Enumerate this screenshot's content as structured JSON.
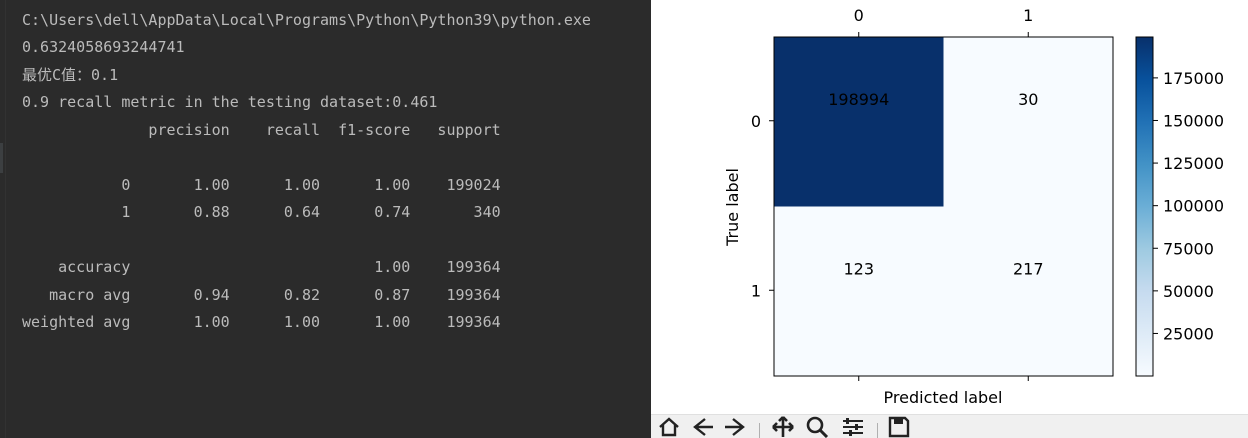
{
  "console": {
    "lines": [
      "C:\\Users\\dell\\AppData\\Local\\Programs\\Python\\Python39\\python.exe",
      "0.6324058693244741",
      "最优C值：0.1",
      "0.9 recall metric in the testing dataset:0.461",
      "              precision    recall  f1-score   support",
      "",
      "           0       1.00      1.00      1.00    199024",
      "           1       0.88      0.64      0.74       340",
      "",
      "    accuracy                           1.00    199364",
      "   macro avg       0.94      0.82      0.87    199364",
      "weighted avg       1.00      1.00      1.00    199364"
    ]
  },
  "chart_data": {
    "type": "heatmap",
    "title": "",
    "xlabel": "Predicted label",
    "ylabel": "True label",
    "x_ticks": [
      "0",
      "1"
    ],
    "y_ticks": [
      "0",
      "1"
    ],
    "matrix": [
      [
        198994,
        30
      ],
      [
        123,
        217
      ]
    ],
    "cell_labels": [
      [
        "198994",
        "30"
      ],
      [
        "123",
        "217"
      ]
    ],
    "colormap": "Blues",
    "colorbar": {
      "ticks": [
        25000,
        50000,
        75000,
        100000,
        125000,
        150000,
        175000
      ],
      "tick_labels": [
        "25000",
        "50000",
        "75000",
        "100000",
        "125000",
        "150000",
        "175000"
      ],
      "range": [
        30,
        198994
      ]
    },
    "x_axis_position": "top",
    "grid": false
  },
  "colors": {
    "console_bg": "#2b2b2b",
    "console_text": "#bbbbbb",
    "cell_high": "#08306b",
    "cell_low": "#f7fbff",
    "toolbar_bg": "#f0f0f0"
  },
  "toolbar": {
    "icons": [
      "home-icon",
      "back-icon",
      "forward-icon",
      "pan-icon",
      "zoom-icon",
      "configure-subplots-icon",
      "save-icon"
    ]
  }
}
